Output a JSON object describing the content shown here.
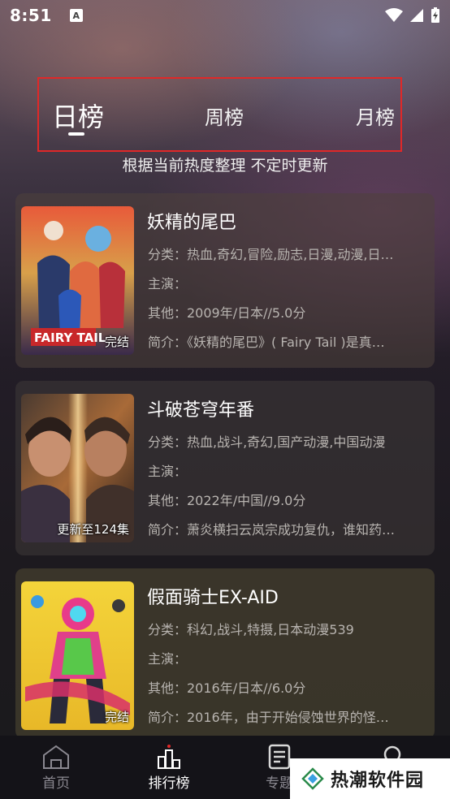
{
  "status_bar": {
    "time": "8:51",
    "notification_glyph": "A"
  },
  "tabs": [
    {
      "label": "日榜",
      "active": true
    },
    {
      "label": "周榜",
      "active": false
    },
    {
      "label": "月榜",
      "active": false
    }
  ],
  "subtitle": "根据当前热度整理 不定时更新",
  "items": [
    {
      "title": "妖精的尾巴",
      "badge": "完结",
      "poster_text": "FAIRY TAIL",
      "category": "分类：热血,奇幻,冒险,励志,日漫,动漫,日…",
      "cast": "主演：",
      "other": "其他：2009年/日本//5.0分",
      "intro": "简介：《妖精的尾巴》( Fairy Tail )是真…"
    },
    {
      "title": "斗破苍穹年番",
      "badge": "更新至124集",
      "category": "分类：热血,战斗,奇幻,国产动漫,中国动漫",
      "cast": "主演：",
      "other": "其他：2022年/中国//9.0分",
      "intro": "简介：萧炎横扫云岚宗成功复仇，谁知药…"
    },
    {
      "title": "假面骑士EX-AID",
      "badge": "完结",
      "category": "分类：科幻,战斗,特摄,日本动漫539",
      "cast": "主演：",
      "other": "其他：2016年/日本//6.0分",
      "intro": "简介：2016年，由于开始侵蚀世界的怪…"
    }
  ],
  "nav": [
    {
      "label": "首页",
      "icon": "home-icon",
      "active": false
    },
    {
      "label": "排行榜",
      "icon": "ranking-icon",
      "active": true
    },
    {
      "label": "专题",
      "icon": "topic-icon",
      "active": false
    },
    {
      "label": "",
      "icon": "search-icon",
      "active": false
    }
  ],
  "watermark": {
    "text": "热潮软件园"
  },
  "colors": {
    "highlight_box": "#e02828",
    "nav_bg": "#141318",
    "inactive_nav": "#8a8890"
  }
}
